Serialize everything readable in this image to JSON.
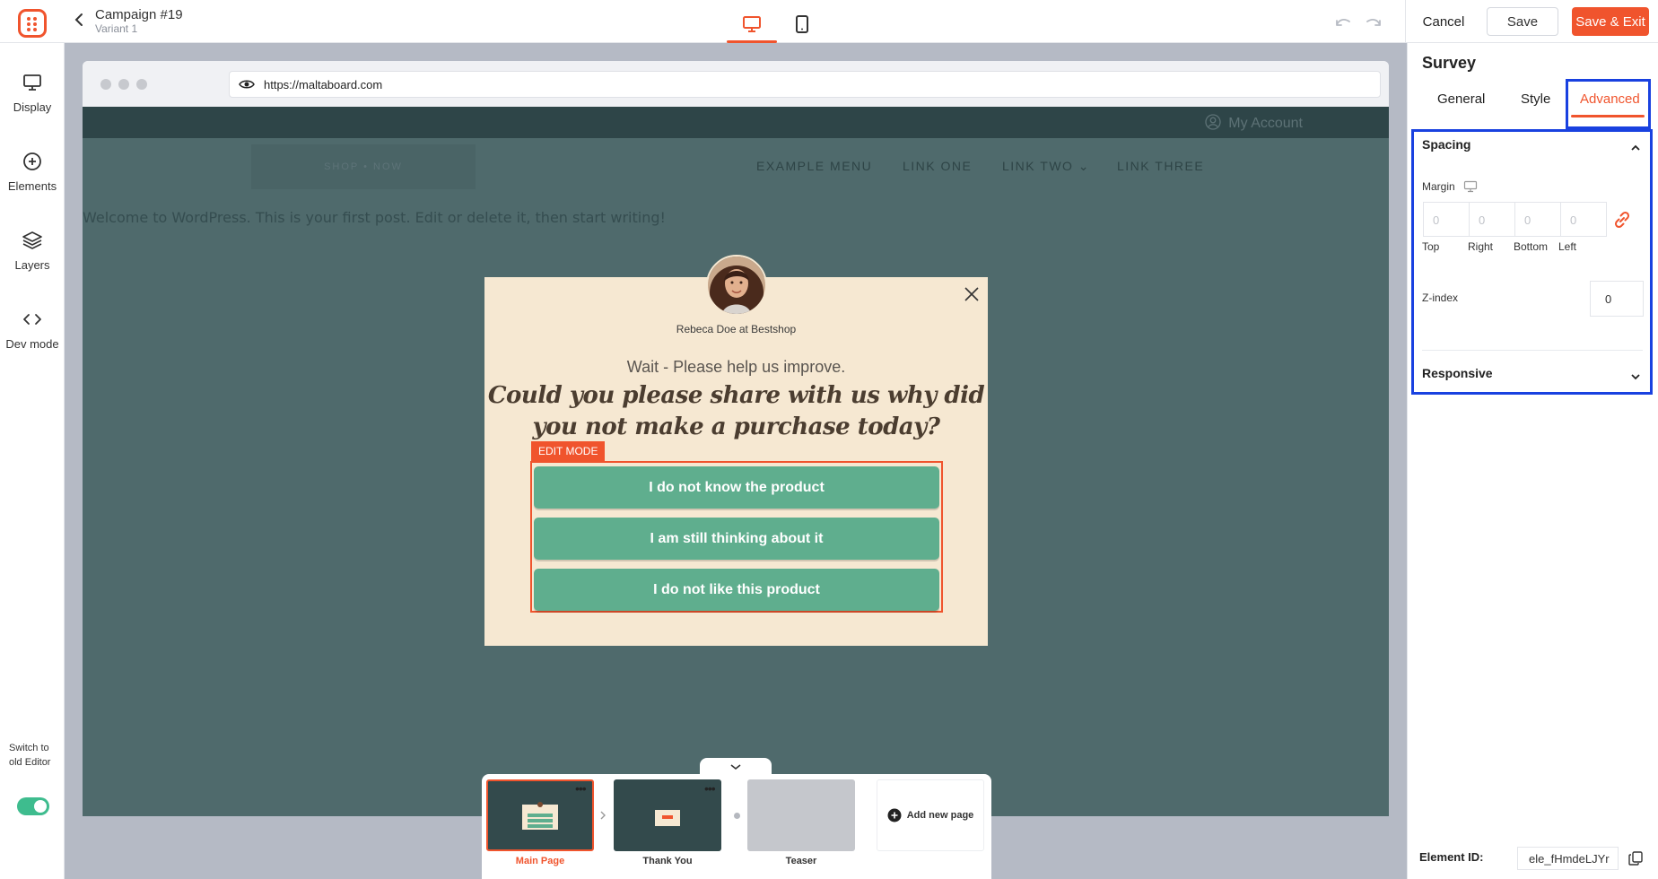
{
  "header": {
    "campaign_title": "Campaign #19",
    "variant": "Variant 1",
    "cancel_label": "Cancel",
    "save_label": "Save",
    "save_exit_label": "Save & Exit"
  },
  "sidebar": {
    "items": [
      {
        "label": "Display",
        "icon": "monitor-icon"
      },
      {
        "label": "Elements",
        "icon": "plus-circle-icon"
      },
      {
        "label": "Layers",
        "icon": "layers-icon"
      },
      {
        "label": "Dev mode",
        "icon": "code-icon"
      }
    ],
    "switch_label": "Switch to old Editor",
    "switch_on": true
  },
  "browser": {
    "url": "https://maltaboard.com"
  },
  "site": {
    "my_account": "My Account",
    "logo_text": "SHOP • NOW",
    "nav": [
      "EXAMPLE MENU",
      "LINK ONE",
      "LINK TWO ⌄",
      "LINK THREE"
    ],
    "welcome": "Welcome to WordPress. This is your first post. Edit or delete it, then start writing!"
  },
  "popup": {
    "byline": "Rebeca Doe at Bestshop",
    "subtitle": "Wait - Please help us improve.",
    "question": "Could you please share with us why did you not make a purchase today?",
    "edit_badge": "EDIT MODE",
    "options": [
      "I do not know the product",
      "I am still thinking about it",
      "I do not like this product"
    ]
  },
  "pages": {
    "items": [
      {
        "label": "Main Page",
        "active": true
      },
      {
        "label": "Thank You",
        "active": false
      },
      {
        "label": "Teaser",
        "active": false
      }
    ],
    "add_label": "Add new page"
  },
  "panel": {
    "title": "Survey",
    "tabs": [
      "General",
      "Style",
      "Advanced"
    ],
    "active_tab": "Advanced",
    "spacing": {
      "title": "Spacing",
      "margin_label": "Margin",
      "placeholders": [
        "0",
        "0",
        "0",
        "0"
      ],
      "labels": [
        "Top",
        "Right",
        "Bottom",
        "Left"
      ]
    },
    "zindex": {
      "label": "Z-index",
      "value": "0"
    },
    "responsive_title": "Responsive",
    "element_id_label": "Element ID:",
    "element_id": "ele_fHmdeLJYr"
  },
  "colors": {
    "accent": "#f0542d",
    "highlight": "#1941e0",
    "survey_button": "#5fae8e",
    "popup_bg": "#f6e8d2",
    "site_bg": "#4f6a6c"
  }
}
